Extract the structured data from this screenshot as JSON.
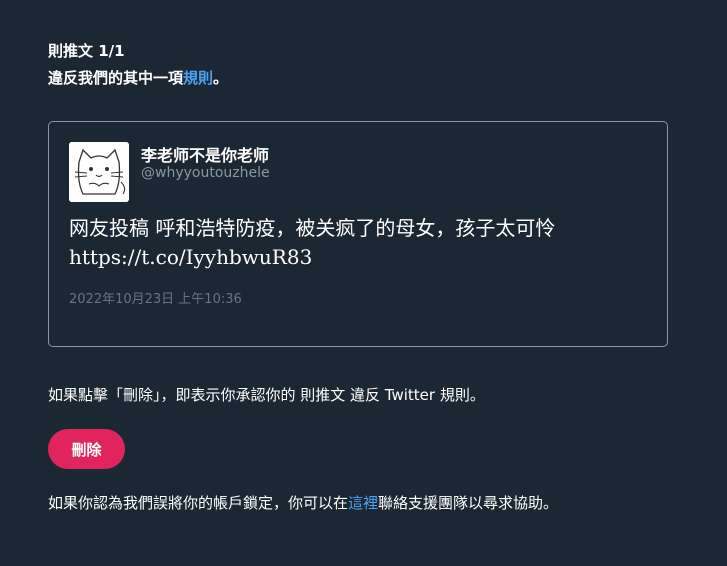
{
  "header": {
    "title": "則推文 1/1",
    "violation_prefix": "違反我們的其中一項",
    "rules_link": "規則",
    "violation_suffix": "。"
  },
  "tweet": {
    "author_name": "李老师不是你老师",
    "author_handle": "@whyyoutouzhele",
    "text_line1": "网友投稿 呼和浩特防疫，被关疯了的母女，孩子太可怜",
    "text_line2": "https://t.co/IyyhbwuR83",
    "date": "2022年10月23日 上午10:36",
    "avatar_icon": "cat-doodle-avatar-icon"
  },
  "notice": {
    "text": "如果點擊「刪除」，即表示你承認你的 則推文 違反 Twitter 規則。"
  },
  "actions": {
    "delete_label": "刪除"
  },
  "appeal": {
    "prefix": "如果你認為我們誤將你的帳戶鎖定，你可以在",
    "link": "這裡",
    "suffix": "聯絡支援團隊以尋求協助。"
  },
  "colors": {
    "background": "#1b2733",
    "link": "#4aa3f2",
    "delete_button": "#e0245e",
    "muted_text": "#8899a6"
  }
}
